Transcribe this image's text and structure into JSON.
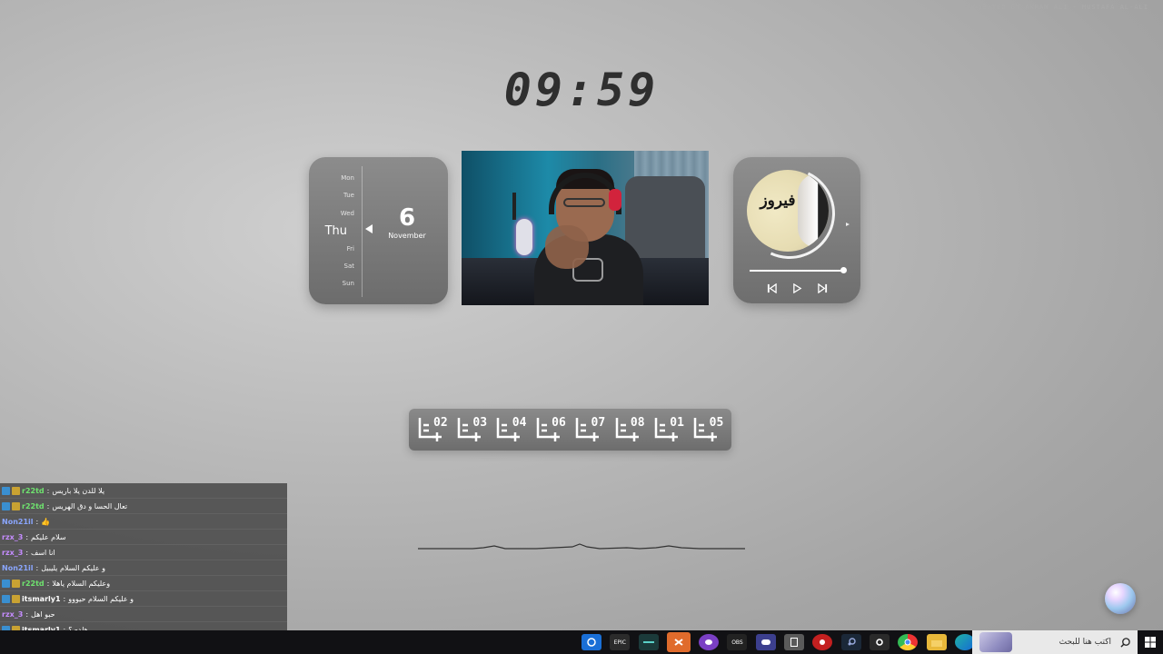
{
  "watermark": "SUGGESTED BY AKRAM ALI - MUSTAFA AL-ALI",
  "clock": {
    "time": "09:59"
  },
  "calendar": {
    "days": [
      "Mon",
      "Tue",
      "Wed",
      "Thu",
      "Fri",
      "Sat",
      "Sun"
    ],
    "active_day": "Thu",
    "date": "6",
    "month": "November"
  },
  "music": {
    "album_text": "فيروز",
    "progress": 1.0,
    "controls": {
      "prev": "skip-back-icon",
      "play": "play-icon",
      "next": "skip-forward-icon"
    }
  },
  "workspaces": [
    "02",
    "03",
    "04",
    "06",
    "07",
    "08",
    "01",
    "05"
  ],
  "chat": {
    "messages": [
      {
        "user": "r22td",
        "text": "يلا للدن يلا باريس",
        "color": "#6fe36f",
        "badges": [
          "blue",
          "gold"
        ]
      },
      {
        "user": "r22td",
        "text": "تعال الحسا و دق الهريس",
        "color": "#6fe36f",
        "badges": [
          "blue",
          "gold"
        ]
      },
      {
        "user": "Non21il",
        "text": "👍",
        "color": "#8aa6ff",
        "badges": []
      },
      {
        "user": "rzx_3",
        "text": "سلام عليكم",
        "color": "#c58cff",
        "badges": []
      },
      {
        "user": "rzx_3",
        "text": "انا اسف",
        "color": "#c58cff",
        "badges": []
      },
      {
        "user": "Non21il",
        "text": "و عليكم السلام يليبيل",
        "color": "#8aa6ff",
        "badges": []
      },
      {
        "user": "r22td",
        "text": "وعليكم السلام ياهلا",
        "color": "#6fe36f",
        "badges": [
          "blue",
          "gold"
        ]
      },
      {
        "user": "itsmarly1",
        "text": "و عليكم السلام حيووو",
        "color": "#ffffff",
        "badges": [
          "blue",
          "gold"
        ]
      },
      {
        "user": "rzx_3",
        "text": "حبو اهل",
        "color": "#c58cff",
        "badges": []
      },
      {
        "user": "itsmarly1",
        "text": "هلدي؟",
        "color": "#ffffff",
        "badges": [
          "blue",
          "gold"
        ]
      }
    ]
  },
  "taskbar": {
    "apps": [
      "app-icon",
      "epic-games-icon",
      "terminal-icon",
      "capcut-icon",
      "discord-icon",
      "obs-icon",
      "controller-icon",
      "calculator-icon",
      "record-icon",
      "steam-icon",
      "settings-icon",
      "chrome-icon",
      "folder-icon",
      "edge-icon"
    ],
    "active_app_index": 3,
    "search_placeholder": "اكتب هنا للبحث",
    "epic_label": "EPIC",
    "obs_label": "OBS"
  },
  "colors": {
    "accent": "#e06b2c",
    "chat_bg": "#4a4a4a"
  }
}
